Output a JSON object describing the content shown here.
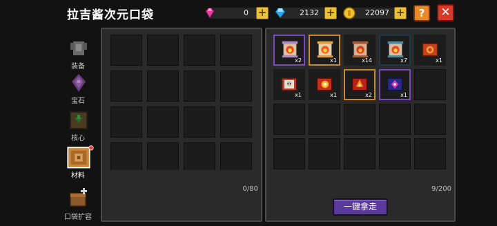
{
  "header": {
    "title": "拉吉酱次元口袋",
    "currencies": [
      {
        "icon": "pink-gem-icon",
        "value": "0"
      },
      {
        "icon": "blue-diamond-icon",
        "value": "2132"
      },
      {
        "icon": "gold-coin-icon",
        "value": "22097"
      }
    ],
    "plus": "+",
    "help": "?",
    "close": "✕"
  },
  "sidebar": {
    "tabs": [
      {
        "label": "装备",
        "icon": "armor-icon"
      },
      {
        "label": "宝石",
        "icon": "purple-gem-icon"
      },
      {
        "label": "核心",
        "icon": "core-icon"
      },
      {
        "label": "材料",
        "icon": "materials-chest-icon",
        "active": true,
        "badge": true
      },
      {
        "label": "口袋扩容",
        "icon": "pocket-expand-icon"
      }
    ]
  },
  "left_panel": {
    "counter": "0/80"
  },
  "right_panel": {
    "counter": "9/200",
    "items": [
      {
        "icon": "purple-scroll-fire-icon",
        "qty": "x2",
        "rarity": "#7a4ab8"
      },
      {
        "icon": "orange-scroll-fire-icon",
        "qty": "x1",
        "rarity": "#c98a2a"
      },
      {
        "icon": "red-scroll-fire-icon",
        "qty": "x14",
        "rarity": "#1c1c1c"
      },
      {
        "icon": "teal-scroll-fire-icon",
        "qty": "x7",
        "rarity": "#1c3a4a"
      },
      {
        "icon": "red-tome-icon",
        "qty": "x1",
        "rarity": "#1c1c1c"
      },
      {
        "icon": "skull-book-icon",
        "qty": "x1",
        "rarity": "#1c1c1c"
      },
      {
        "icon": "fire-book-icon",
        "qty": "x1",
        "rarity": "#1c1c1c"
      },
      {
        "icon": "flame-book-icon",
        "qty": "x2",
        "rarity": "#c98a2a"
      },
      {
        "icon": "purple-rune-book-icon",
        "qty": "x1",
        "rarity": "#7a4ab8"
      }
    ],
    "take_all_label": "一键拿走"
  }
}
